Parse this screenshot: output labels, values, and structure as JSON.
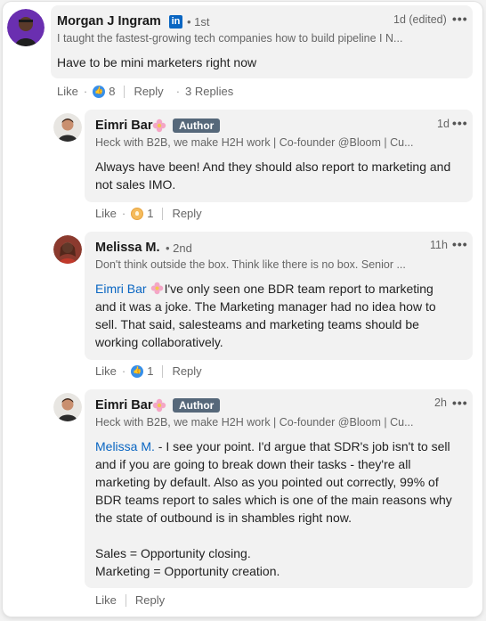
{
  "comments": [
    {
      "name": "Morgan J Ingram",
      "degree": "1st",
      "headline": "I taught the fastest-growing tech companies how to build pipeline I N...",
      "time": "1d (edited)",
      "body": "Have to be mini marketers right now",
      "actions": {
        "like": "Like",
        "count": "8",
        "reply": "Reply",
        "replies": "3 Replies"
      }
    },
    {
      "name": "Eimri Bar",
      "badge": "Author",
      "headline": "Heck with B2B, we make H2H work | Co-founder @Bloom | Cu...",
      "time": "1d",
      "body": "Always have been! And they should also report to marketing and not sales IMO.",
      "actions": {
        "like": "Like",
        "count": "1",
        "reply": "Reply"
      }
    },
    {
      "name": "Melissa M.",
      "degree": "2nd",
      "headline": "Don't think outside the box. Think like there is no box. Senior ...",
      "time": "11h",
      "mention": "Eimri Bar",
      "body": "I've only seen one BDR team report to marketing and it was a joke. The Marketing manager had no idea how to sell. That said, salesteams and marketing teams should be working collaboratively.",
      "actions": {
        "like": "Like",
        "count": "1",
        "reply": "Reply"
      }
    },
    {
      "name": "Eimri Bar",
      "badge": "Author",
      "headline": "Heck with B2B, we make H2H work | Co-founder @Bloom | Cu...",
      "time": "2h",
      "mention": "Melissa M.",
      "body1": " - I see your point. I'd argue that SDR's job isn't to sell and if you are going to break down their tasks - they're all marketing by default. Also as you pointed out correctly, 99% of BDR teams report to sales which is one of the main reasons why the state of outbound is in shambles right now.",
      "body2": "Sales = Opportunity closing.",
      "body3": "Marketing = Opportunity creation.",
      "actions": {
        "like": "Like",
        "reply": "Reply"
      }
    }
  ],
  "colors": {
    "mention": "#0a66c2",
    "like": "#378fe9",
    "badge": "#56687a"
  },
  "icons": [
    "linkedin-icon",
    "more-icon",
    "like-reaction-icon",
    "insightful-reaction-icon",
    "flower-emoji-icon"
  ]
}
